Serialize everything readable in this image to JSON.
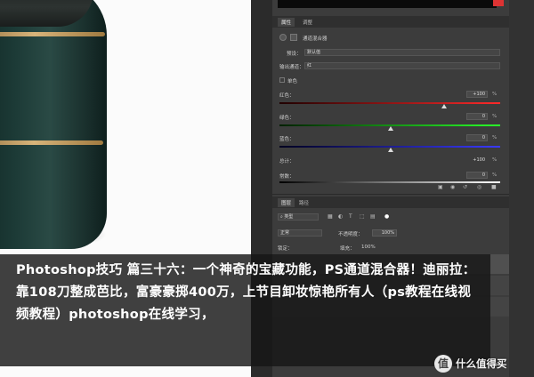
{
  "caption": {
    "text": "Photoshop技巧 篇三十六：一个神奇的宝藏功能，PS通道混合器！迪丽拉：靠108刀整成芭比，富豪豪掷400万，上节目卸妆惊艳所有人（ps教程在线视频教程）photoshop在线学习，"
  },
  "watermark": {
    "logo_glyph": "值",
    "text": "什么值得买"
  },
  "panel": {
    "tabs_top": [
      "属性",
      "调整"
    ],
    "title": "通道混合器",
    "preset_label": "预设：",
    "preset_value": "默认值",
    "output_label": "输出通道：",
    "output_value": "红",
    "mono_label": "单色",
    "red_label": "红色：",
    "red_value": "+100",
    "green_label": "绿色：",
    "green_value": "0",
    "blue_label": "蓝色：",
    "blue_value": "0",
    "total_label": "总计：",
    "total_value": "+100",
    "const_label": "常数：",
    "const_value": "0",
    "pct": "%",
    "tabs_layers": [
      "图层",
      "路径"
    ],
    "kind_label": "类型",
    "blend_mode": "正常",
    "opacity_label": "不透明度：",
    "opacity_value": "100%",
    "lock_label": "锁定：",
    "fill_label": "填充：",
    "fill_value": "100%"
  },
  "colors": {
    "panel_bg": "#3c3c3c",
    "caption_bg": "#161616",
    "fryer_green": "#1c3a36",
    "gold_trim": "#d8b47a"
  }
}
